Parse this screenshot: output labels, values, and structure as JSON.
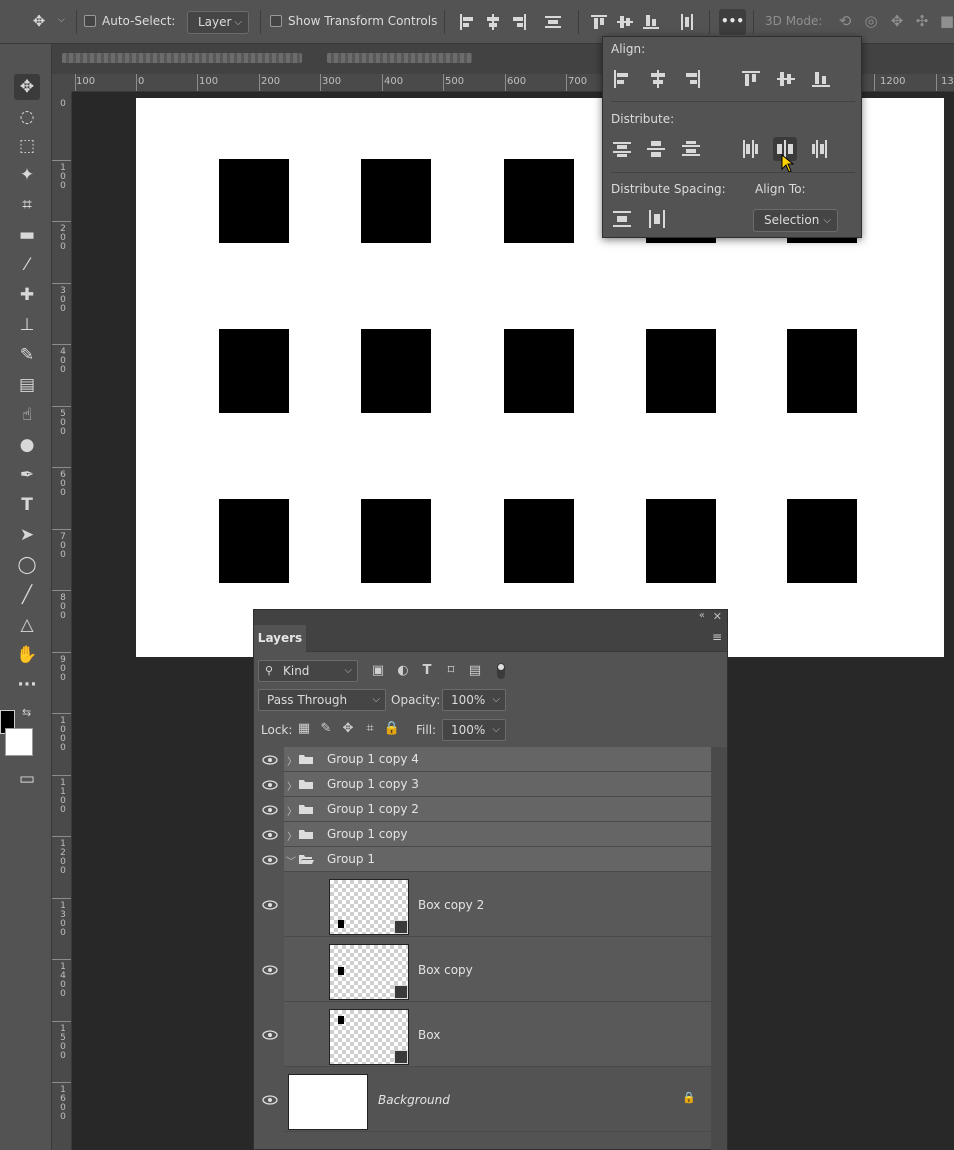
{
  "options_bar": {
    "move_icon": "move-icon",
    "auto_select_label": "Auto-Select:",
    "auto_select_target": "Layer",
    "show_transform_label": "Show Transform Controls",
    "more_label": "•••",
    "mode_3d_label": "3D Mode:"
  },
  "rulers": {
    "horizontal": [
      "100",
      "0",
      "100",
      "200",
      "300",
      "400",
      "500",
      "600",
      "700",
      "1200",
      "13"
    ],
    "vertical": [
      "0",
      "100",
      "200",
      "300",
      "400",
      "500",
      "600",
      "700",
      "800",
      "900",
      "1000",
      "1100",
      "1200",
      "1300",
      "1400",
      "1500",
      "1600"
    ]
  },
  "align_popup": {
    "align_label": "Align:",
    "distribute_label": "Distribute:",
    "distribute_spacing_label": "Distribute Spacing:",
    "align_to_label": "Align To:",
    "align_to_value": "Selection"
  },
  "layers_panel": {
    "tab_label": "Layers",
    "filter_kind": "Kind",
    "blend_mode": "Pass Through",
    "opacity_label": "Opacity:",
    "opacity_value": "100%",
    "lock_label": "Lock:",
    "fill_label": "Fill:",
    "fill_value": "100%",
    "groups": [
      {
        "name": "Group 1 copy 4"
      },
      {
        "name": "Group 1 copy 3"
      },
      {
        "name": "Group 1 copy 2"
      },
      {
        "name": "Group 1 copy"
      },
      {
        "name": "Group 1"
      }
    ],
    "layers": [
      {
        "name": "Box copy 2"
      },
      {
        "name": "Box copy"
      },
      {
        "name": "Box"
      }
    ],
    "background_layer": "Background"
  },
  "colors": {
    "foreground": "#000000",
    "background": "#ffffff",
    "canvas": "#ffffff",
    "box": "#000000"
  }
}
